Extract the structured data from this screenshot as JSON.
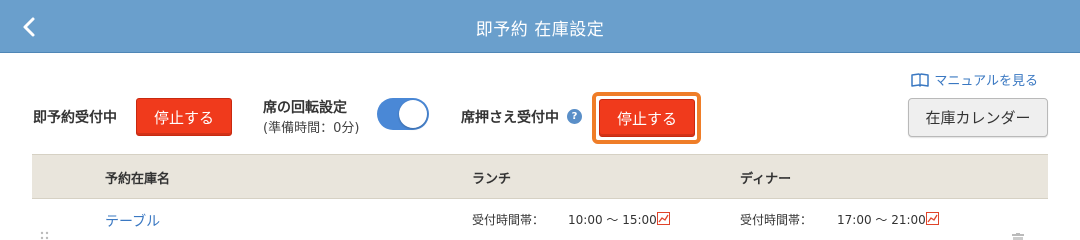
{
  "header": {
    "title": "即予約 在庫設定",
    "back_icon": "chevron-left-icon"
  },
  "manual": {
    "label": "マニュアルを見る",
    "icon": "book-icon"
  },
  "instant_booking": {
    "status_label": "即予約受付中",
    "stop_label": "停止する"
  },
  "rotation": {
    "title": "席の回転設定",
    "sub": "(準備時間：0分)",
    "enabled": true
  },
  "hold_seats": {
    "status_label": "席押さえ受付中",
    "help": "?",
    "stop_label": "停止する"
  },
  "calendar_button": {
    "label": "在庫カレンダー"
  },
  "table": {
    "headers": {
      "name": "予約在庫名",
      "lunch": "ランチ",
      "dinner": "ディナー"
    },
    "rows": [
      {
        "name": "テーブル",
        "lunch": {
          "label": "受付時間帯：",
          "time": "10:00 〜 15:00"
        },
        "dinner": {
          "label": "受付時間帯：",
          "time": "17:00 〜 21:00"
        }
      }
    ]
  },
  "colors": {
    "header_bg": "#6a9fcc",
    "stop_red": "#f03a1c",
    "highlight_orange": "#ef7d28",
    "toggle_blue": "#4a88d6",
    "table_head_bg": "#e9e5dc"
  }
}
